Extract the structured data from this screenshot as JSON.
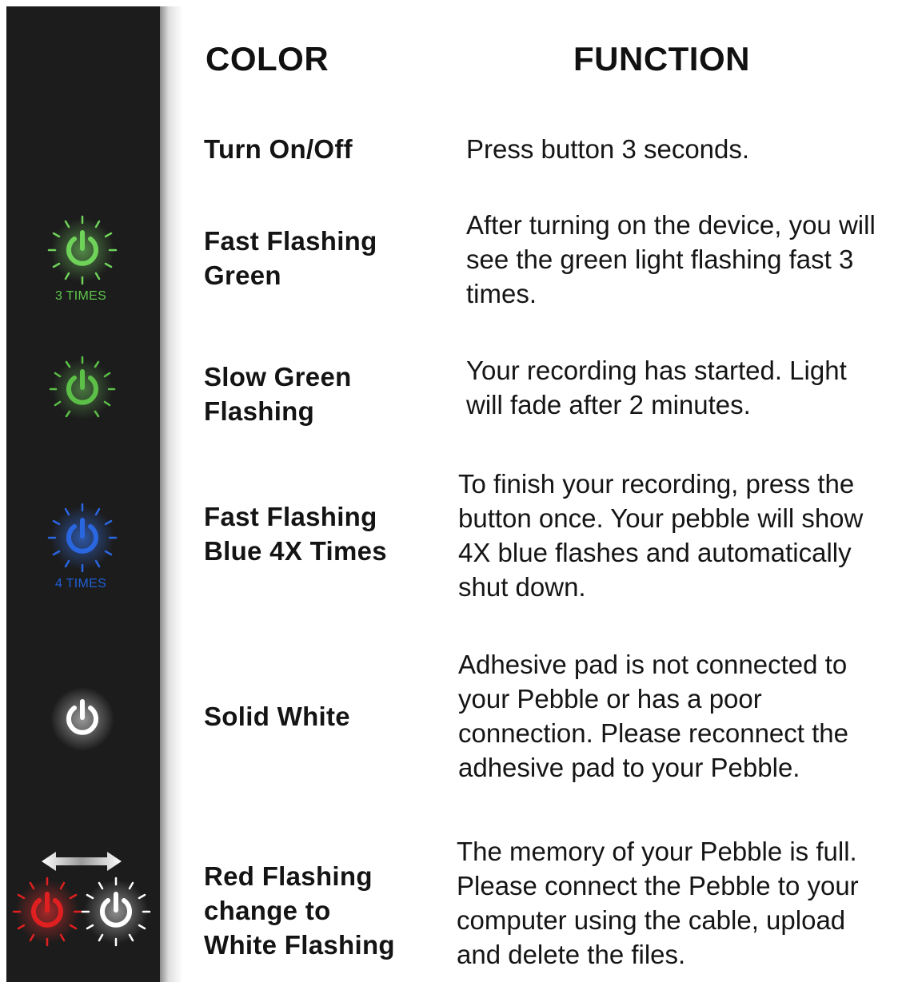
{
  "headers": {
    "color": "COLOR",
    "function": "FUNCTION"
  },
  "rows": [
    {
      "label": "Turn On/Off",
      "description": "Press button 3 seconds."
    },
    {
      "label": "Fast Flashing\nGreen",
      "description": "After turning on the device, you will\nsee the green light flashing fast 3\ntimes.",
      "icon": "green-power-rays-icon",
      "caption": "3 TIMES",
      "color": "#5ec84a"
    },
    {
      "label": "Slow Green\nFlashing",
      "description": "Your recording has started. Light\nwill fade after 2 minutes.",
      "icon": "green-power-rays-icon",
      "color": "#5ec84a"
    },
    {
      "label": "Fast Flashing\nBlue 4X Times",
      "description": "To finish your recording, press the\nbutton once. Your pebble will show\n4X blue flashes and automatically\nshut down.",
      "icon": "blue-power-rays-icon",
      "caption": "4 TIMES",
      "color": "#1f5fd6"
    },
    {
      "label": "Solid White",
      "description": "Adhesive pad is not connected to\nyour Pebble or has a poor\nconnection. Please reconnect the\nadhesive pad to your Pebble.",
      "icon": "white-power-icon",
      "color": "#ffffff"
    },
    {
      "label": "Red Flashing\nchange to\nWhite Flashing",
      "description": "The memory of your Pebble is full.\nPlease connect the Pebble to your\ncomputer using the cable, upload\nand delete the files.",
      "icon": "red-white-power-alternating-icon",
      "color": "#e02020"
    }
  ]
}
